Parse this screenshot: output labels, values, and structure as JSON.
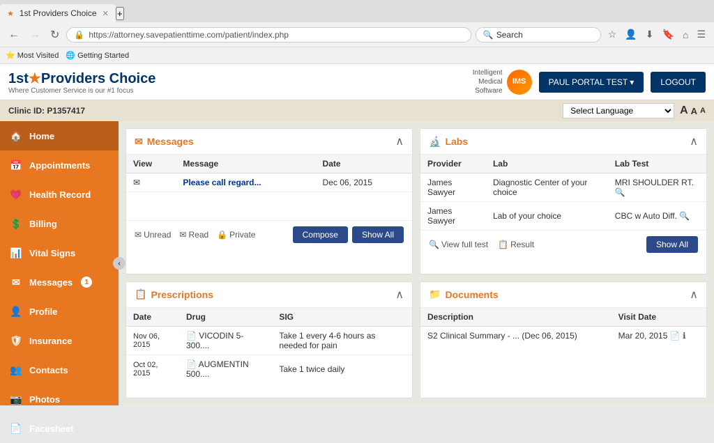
{
  "browser": {
    "tab_title": "1st Providers Choice",
    "url": "https://attorney.savepatienttime.com/patient/index.php",
    "search_placeholder": "Search",
    "bookmarks": [
      "Most Visited",
      "Getting Started"
    ]
  },
  "header": {
    "logo_prefix": "1st",
    "logo_star": "★",
    "logo_suffix": "Providers Choice",
    "logo_tagline": "Where Customer Service is our #1 focus",
    "ims_line1": "Intelligent",
    "ims_line2": "Medical",
    "ims_line3": "Software",
    "portal_btn": "PAUL PORTAL TEST ▾",
    "logout_btn": "LOGOUT"
  },
  "clinic_bar": {
    "label": "Clinic ID: P1357417",
    "lang_placeholder": "Select Language",
    "text_a_large": "A",
    "text_a_medium": "A",
    "text_a_small": "A"
  },
  "sidebar": {
    "items": [
      {
        "id": "home",
        "label": "Home",
        "icon": "🏠",
        "active": true
      },
      {
        "id": "appointments",
        "label": "Appointments",
        "icon": "📅"
      },
      {
        "id": "health-record",
        "label": "Health Record",
        "icon": "💗"
      },
      {
        "id": "billing",
        "label": "Billing",
        "icon": "💲"
      },
      {
        "id": "vital-signs",
        "label": "Vital Signs",
        "icon": "📊"
      },
      {
        "id": "messages",
        "label": "Messages",
        "icon": "✉",
        "badge": "1"
      },
      {
        "id": "profile",
        "label": "Profile",
        "icon": "👤"
      },
      {
        "id": "insurance",
        "label": "Insurance",
        "icon": "🛡"
      },
      {
        "id": "contacts",
        "label": "Contacts",
        "icon": "👥"
      },
      {
        "id": "photos",
        "label": "Photos",
        "icon": "📷"
      },
      {
        "id": "facesheet",
        "label": "Facesheet",
        "icon": "📄"
      }
    ]
  },
  "messages_panel": {
    "title": "Messages",
    "col_view": "View",
    "col_message": "Message",
    "col_date": "Date",
    "rows": [
      {
        "icon": "✉",
        "message": "Please call regard...",
        "date": "Dec 06, 2015"
      }
    ],
    "footer_unread": "Unread",
    "footer_read": "Read",
    "footer_private": "Private",
    "btn_compose": "Compose",
    "btn_show_all": "Show All"
  },
  "labs_panel": {
    "title": "Labs",
    "col_provider": "Provider",
    "col_lab": "Lab",
    "col_lab_test": "Lab Test",
    "rows": [
      {
        "provider": "James Sawyer",
        "lab": "Diagnostic Center of your choice",
        "lab_test": "MRI SHOULDER RT."
      },
      {
        "provider": "James Sawyer",
        "lab": "Lab of your choice",
        "lab_test": "CBC w Auto Diff."
      }
    ],
    "footer_view": "View full test",
    "footer_result": "Result",
    "btn_show_all": "Show All"
  },
  "prescriptions_panel": {
    "title": "Prescriptions",
    "col_date": "Date",
    "col_drug": "Drug",
    "col_sig": "SIG",
    "rows": [
      {
        "date": "Nov 06, 2015",
        "drug": "VICODIN 5-300....",
        "sig": "Take 1 every 4-6 hours as needed for pain"
      },
      {
        "date": "Oct 02, 2015",
        "drug": "AUGMENTIN 500....",
        "sig": "Take 1 twice daily"
      }
    ]
  },
  "documents_panel": {
    "title": "Documents",
    "col_description": "Description",
    "col_visit_date": "Visit Date",
    "rows": [
      {
        "description": "S2 Clinical Summary - ... (Dec 06, 2015)",
        "visit_date": "Mar 20, 2015"
      }
    ]
  }
}
